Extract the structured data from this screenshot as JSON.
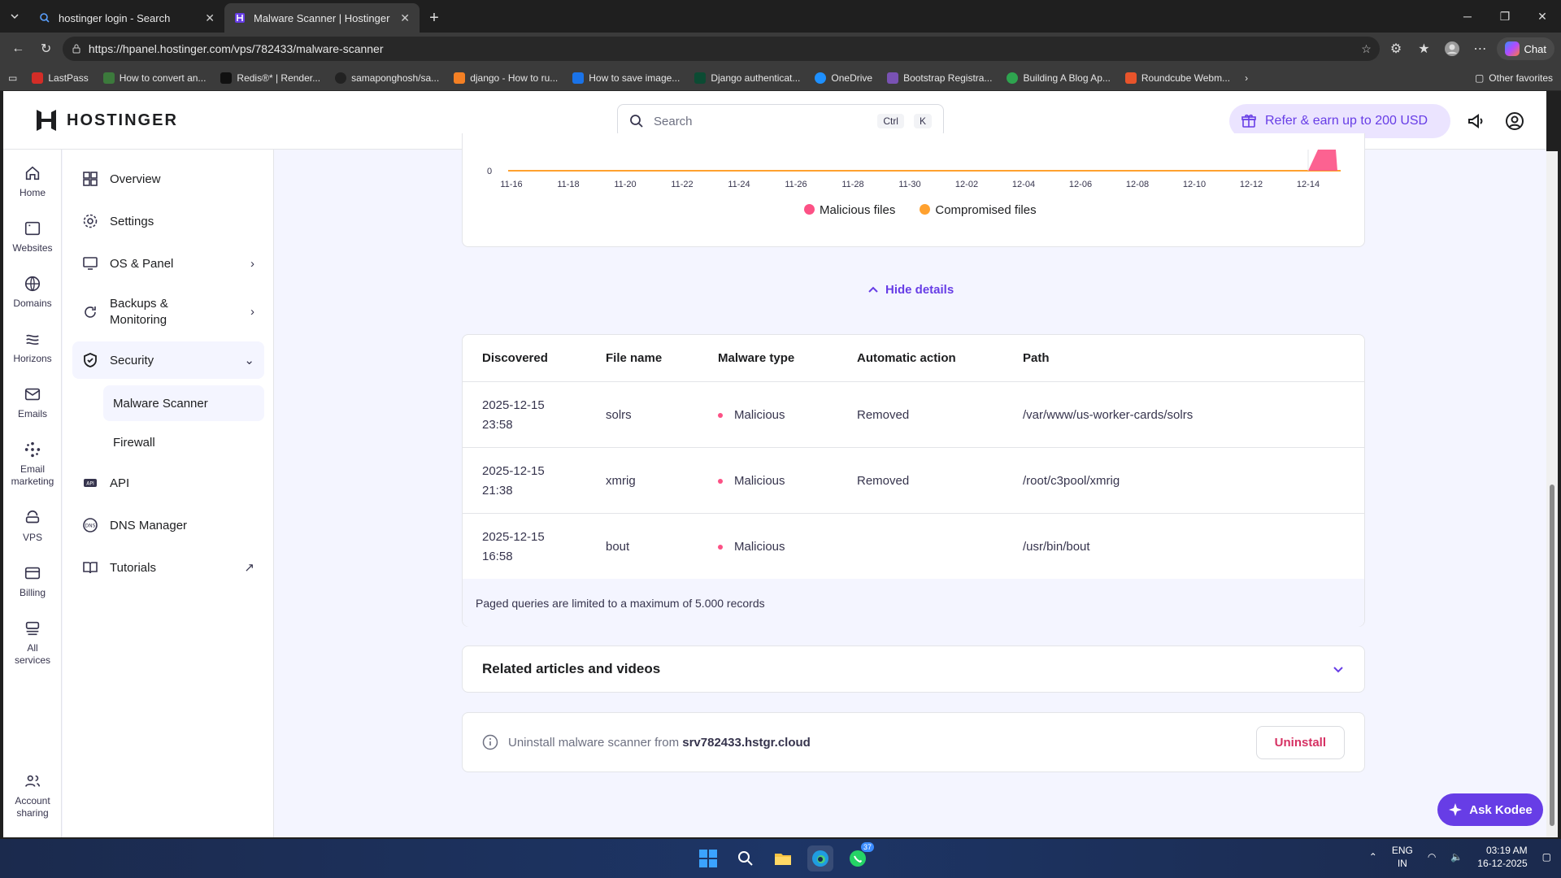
{
  "browser": {
    "tabs": [
      {
        "title": "hostinger login - Search",
        "active": false
      },
      {
        "title": "Malware Scanner | Hostinger",
        "active": true
      }
    ],
    "url": "https://hpanel.hostinger.com/vps/782433/malware-scanner",
    "chat_label": "Chat",
    "favorites": [
      "LastPass",
      "How to convert an...",
      "Redis®* | Render...",
      "samaponghosh/sa...",
      "django - How to ru...",
      "How to save image...",
      "Django authenticat...",
      "OneDrive",
      "Bootstrap Registra...",
      "Building A Blog Ap...",
      "Roundcube Webm..."
    ],
    "other_favorites": "Other favorites"
  },
  "header": {
    "brand": "HOSTINGER",
    "search_placeholder": "Search",
    "kbd_ctrl": "Ctrl",
    "kbd_k": "K",
    "refer_label": "Refer & earn up to 200 USD"
  },
  "rail": [
    {
      "label": "Home",
      "icon": "home-icon"
    },
    {
      "label": "Websites",
      "icon": "websites-icon"
    },
    {
      "label": "Domains",
      "icon": "globe-icon"
    },
    {
      "label": "Horizons",
      "icon": "horizons-icon"
    },
    {
      "label": "Emails",
      "icon": "mail-icon"
    },
    {
      "label": "Email marketing",
      "icon": "email-marketing-icon"
    },
    {
      "label": "VPS",
      "icon": "vps-icon"
    },
    {
      "label": "Billing",
      "icon": "billing-icon"
    },
    {
      "label": "All services",
      "icon": "all-services-icon"
    },
    {
      "label": "Account sharing",
      "icon": "account-sharing-icon"
    }
  ],
  "sidebar": {
    "items": [
      {
        "label": "Overview"
      },
      {
        "label": "Settings"
      },
      {
        "label": "OS & Panel"
      },
      {
        "label": "Backups & Monitoring"
      },
      {
        "label": "Security"
      },
      {
        "label": "API"
      },
      {
        "label": "DNS Manager"
      },
      {
        "label": "Tutorials"
      }
    ],
    "security_sub": [
      {
        "label": "Malware Scanner"
      },
      {
        "label": "Firewall"
      }
    ]
  },
  "chart_data": {
    "type": "area",
    "x": [
      "11-16",
      "11-18",
      "11-20",
      "11-22",
      "11-24",
      "11-26",
      "11-28",
      "11-30",
      "12-02",
      "12-04",
      "12-06",
      "12-08",
      "12-10",
      "12-12",
      "12-14"
    ],
    "yticks_visible": [
      "0"
    ],
    "series": [
      {
        "name": "Malicious files",
        "color": "#fc5185"
      },
      {
        "name": "Compromised files",
        "color": "#ffa12f"
      }
    ]
  },
  "details": {
    "toggle_label": "Hide details",
    "columns": [
      "Discovered",
      "File name",
      "Malware type",
      "Automatic action",
      "Path"
    ],
    "rows": [
      {
        "date": "2025-12-15",
        "time": "23:58",
        "file": "solrs",
        "type": "Malicious",
        "action": "Removed",
        "path": "/var/www/us-worker-cards/solrs"
      },
      {
        "date": "2025-12-15",
        "time": "21:38",
        "file": "xmrig",
        "type": "Malicious",
        "action": "Removed",
        "path": "/root/c3pool/xmrig"
      },
      {
        "date": "2025-12-15",
        "time": "16:58",
        "file": "bout",
        "type": "Malicious",
        "action": "",
        "path": "/usr/bin/bout"
      }
    ],
    "footer_note": "Paged queries are limited to a maximum of 5.000 records"
  },
  "related": {
    "title": "Related articles and videos"
  },
  "uninstall": {
    "text": "Uninstall malware scanner from",
    "host": "srv782433.hstgr.cloud",
    "button": "Uninstall"
  },
  "ask_kodee": "Ask Kodee",
  "taskbar": {
    "lang_1": "ENG",
    "lang_2": "IN",
    "time": "03:19 AM",
    "date": "16-12-2025",
    "badge": "37"
  },
  "colors": {
    "accent": "#673de6",
    "malicious": "#fc5185",
    "compromised": "#ffa12f",
    "danger": "#d63163"
  }
}
